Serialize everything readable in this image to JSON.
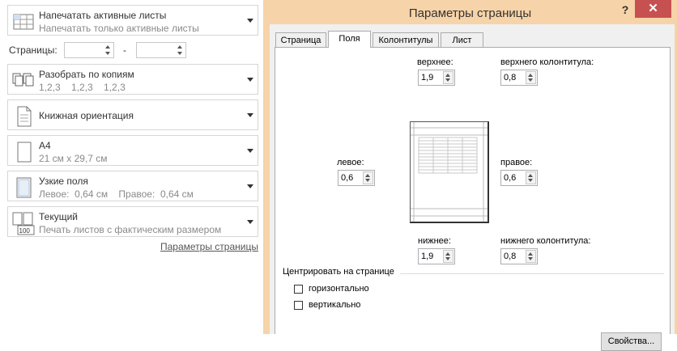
{
  "print_panel": {
    "active_sheets": {
      "title": "Напечатать активные листы",
      "subtitle": "Напечатать только активные листы"
    },
    "pages": {
      "label": "Страницы:",
      "from_value": "",
      "to_value": "",
      "dash": "-"
    },
    "collate": {
      "title": "Разобрать по копиям",
      "subtitle": "1,2,3    1,2,3    1,2,3"
    },
    "orientation": {
      "title": "Книжная ориентация"
    },
    "paper": {
      "title": "А4",
      "subtitle": "21 см x 29,7 см"
    },
    "margins": {
      "title": "Узкие поля",
      "subtitle": "Левое:  0,64 см    Правое:  0,64 см"
    },
    "scaling": {
      "title": "Текущий",
      "subtitle": "Печать листов с фактическим размером",
      "icon_text": "100"
    },
    "page_setup_link": "Параметры страницы"
  },
  "dialog": {
    "title": "Параметры страницы",
    "help": "?",
    "close": "✕",
    "tabs": [
      {
        "label": "Страница",
        "active": false
      },
      {
        "label": "Поля",
        "active": true
      },
      {
        "label": "Колонтитулы",
        "active": false
      },
      {
        "label": "Лист",
        "active": false
      }
    ],
    "fields": {
      "top": {
        "label": "верхнее:",
        "value": "1,9"
      },
      "header": {
        "label": "верхнего колонтитула:",
        "value": "0,8"
      },
      "left": {
        "label": "левое:",
        "value": "0,6"
      },
      "right": {
        "label": "правое:",
        "value": "0,6"
      },
      "bottom": {
        "label": "нижнее:",
        "value": "1,9"
      },
      "footer": {
        "label": "нижнего колонтитула:",
        "value": "0,8"
      }
    },
    "center": {
      "legend": "Центрировать на странице",
      "horizontal": {
        "label": "горизонтально",
        "checked": false
      },
      "vertical": {
        "label": "вертикально",
        "checked": false
      }
    },
    "properties_button": "Свойства..."
  },
  "colors": {
    "dialog_frame": "#f6d3a8",
    "close_button": "#c75050",
    "panel_border": "#d6d6d6"
  }
}
